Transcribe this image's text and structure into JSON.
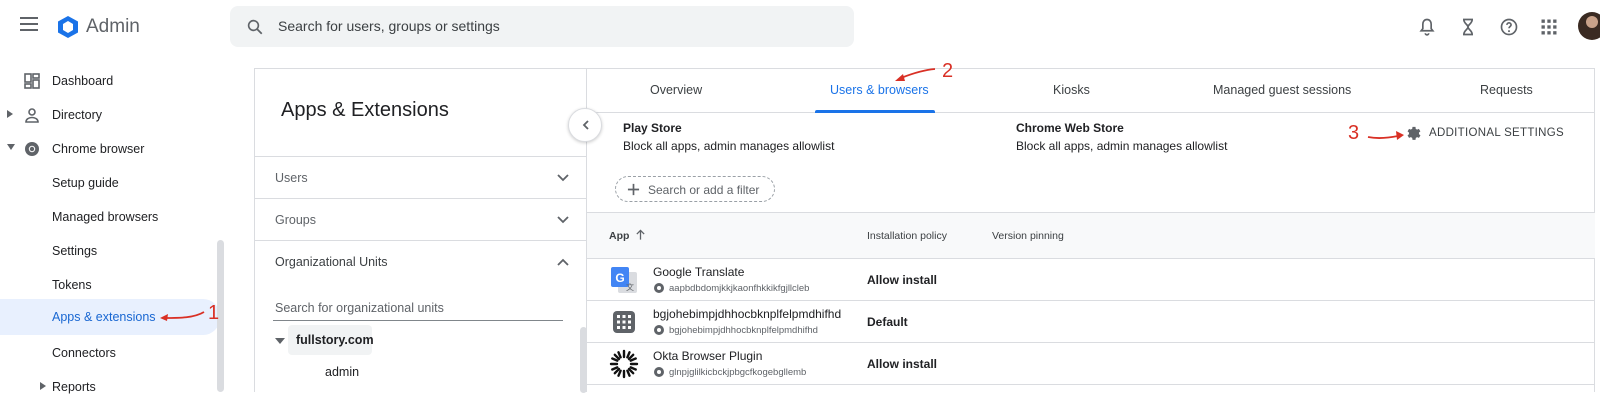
{
  "header": {
    "brand": "Admin",
    "search_placeholder": "Search for users, groups or settings",
    "icons": [
      "bell-icon",
      "hourglass-icon",
      "help-icon",
      "apps-grid-icon"
    ]
  },
  "nav": {
    "items": [
      {
        "label": "Dashboard",
        "icon": "dashboard-icon"
      },
      {
        "label": "Directory",
        "icon": "person-icon"
      },
      {
        "label": "Chrome browser",
        "icon": "chrome-icon"
      },
      {
        "label": "Setup guide"
      },
      {
        "label": "Managed browsers"
      },
      {
        "label": "Settings"
      },
      {
        "label": "Tokens"
      },
      {
        "label": "Apps & extensions"
      },
      {
        "label": "Connectors"
      },
      {
        "label": "Reports"
      }
    ]
  },
  "middle": {
    "title": "Apps & Extensions",
    "sections": [
      "Users",
      "Groups",
      "Organizational Units"
    ],
    "ou_search_placeholder": "Search for organizational units",
    "tree_root": "fullstory.com",
    "tree_child": "admin"
  },
  "tabs": [
    "Overview",
    "Users & browsers",
    "Kiosks",
    "Managed guest sessions",
    "Requests"
  ],
  "stores": [
    {
      "title": "Play Store",
      "desc": "Block all apps, admin manages allowlist"
    },
    {
      "title": "Chrome Web Store",
      "desc": "Block all apps, admin manages allowlist"
    }
  ],
  "additional_settings_label": "ADDITIONAL SETTINGS",
  "filter_placeholder": "Search or add a filter",
  "table": {
    "headers": [
      "App",
      "Installation policy",
      "Version pinning"
    ],
    "rows": [
      {
        "name": "Google Translate",
        "id": "aapbdbdomjkkjkaonfhkkikfgjllcleb",
        "policy": "Allow install",
        "icon": "google-translate-icon"
      },
      {
        "name": "bgjohebimpjdhhocbknplfelpmdhifhd",
        "id": "bgjohebimpjdhhocbknplfelpmdhifhd",
        "policy": "Default",
        "icon": "grid-app-icon"
      },
      {
        "name": "Okta Browser Plugin",
        "id": "glnpjglilkicbckjpbgcfkogebgllemb",
        "policy": "Allow install",
        "icon": "okta-icon"
      }
    ]
  },
  "annotations": [
    "1",
    "2",
    "3"
  ],
  "colors": {
    "accent": "#1a73e8",
    "active_bg": "#e8f0fe",
    "annotation": "#d93025"
  }
}
